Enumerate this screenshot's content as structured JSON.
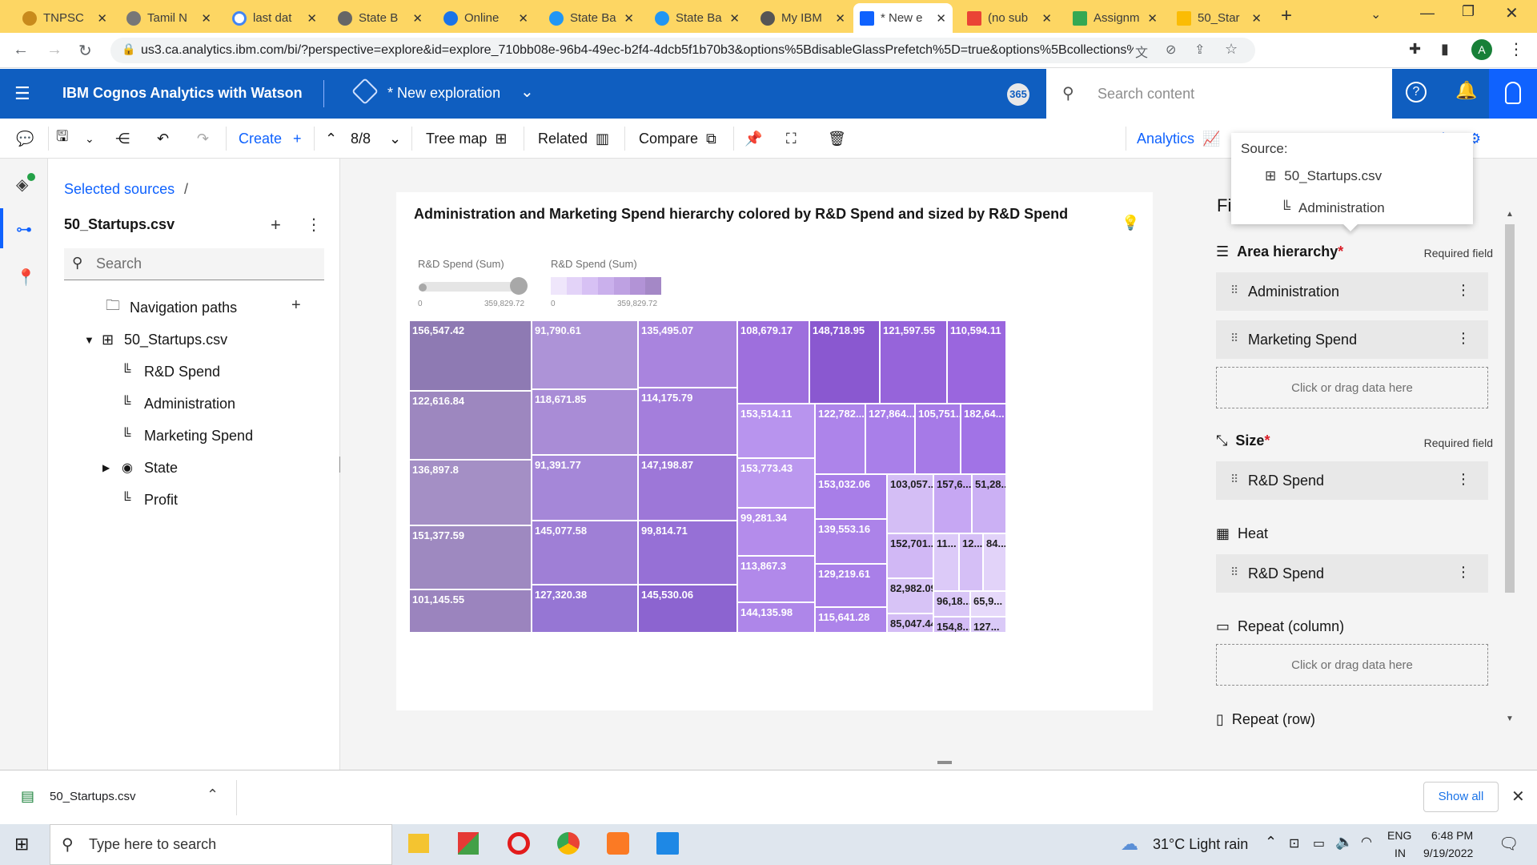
{
  "browser": {
    "tabs": [
      {
        "label": "TNPSC",
        "active": false
      },
      {
        "label": "Tamil N",
        "active": false
      },
      {
        "label": "last dat",
        "active": false
      },
      {
        "label": "State B",
        "active": false
      },
      {
        "label": "Online",
        "active": false
      },
      {
        "label": "State Ba",
        "active": false
      },
      {
        "label": "State Ba",
        "active": false
      },
      {
        "label": "My IBM",
        "active": false
      },
      {
        "label": "* New e",
        "active": true
      },
      {
        "label": "(no sub",
        "active": false
      },
      {
        "label": "Assignm",
        "active": false
      },
      {
        "label": "50_Star",
        "active": false
      }
    ],
    "url": "us3.ca.analytics.ibm.com/bi/?perspective=explore&id=explore_710bb08e-96b4-49ec-b2f4-4dcb5f1b70b3&options%5BdisableGlassPrefetch%5D=true&options%5Bcollections%5D...",
    "profile_initial": "A"
  },
  "header": {
    "app_title": "IBM Cognos Analytics with Watson",
    "exploration_title": "* New exploration",
    "badge": "365",
    "search_placeholder": "Search content"
  },
  "toolbar": {
    "create_label": "Create",
    "page_counter": "8/8",
    "treemap_label": "Tree map",
    "related_label": "Related",
    "compare_label": "Compare",
    "analytics_label": "Analytics",
    "properties_label": "rties"
  },
  "source_panel": {
    "breadcrumb": "Selected sources",
    "breadcrumb_sep": "/",
    "source_name": "50_Startups.csv",
    "search_placeholder": "Search",
    "tree": [
      {
        "label": "Navigation paths",
        "icon": "folder-icon"
      },
      {
        "label": "50_Startups.csv",
        "icon": "table-icon"
      },
      {
        "label": "R&D Spend",
        "icon": "measure-icon"
      },
      {
        "label": "Administration",
        "icon": "measure-icon"
      },
      {
        "label": "Marketing Spend",
        "icon": "measure-icon"
      },
      {
        "label": "State",
        "icon": "location-icon"
      },
      {
        "label": "Profit",
        "icon": "measure-icon"
      }
    ]
  },
  "visualization": {
    "title": "Administration and Marketing Spend hierarchy colored by R&D Spend and sized by R&D Spend",
    "legend_size_label": "R&D Spend (Sum)",
    "legend_color_label": "R&D Spend (Sum)",
    "legend_min": "0",
    "legend_max": "359,829.72",
    "treemap_labels": [
      "156,547.42",
      "122,616.84",
      "136,897.8",
      "151,377.59",
      "101,145.55",
      "91,790.61",
      "118,671.85",
      "91,391.77",
      "145,077.58",
      "127,320.38",
      "135,495.07",
      "114,175.79",
      "147,198.87",
      "99,814.71",
      "145,530.06",
      "108,679.17",
      "148,718.95",
      "121,597.55",
      "110,594.11",
      "153,514.11",
      "153,773.43",
      "99,281.34",
      "113,867.3",
      "144,135.98",
      "122,782....",
      "127,864....",
      "105,751...",
      "182,64...",
      "153,032.06",
      "139,553.16",
      "129,219.61",
      "115,641.28",
      "103,057...",
      "157,6...",
      "51,28...",
      "152,701...",
      "11...",
      "12...",
      "84...",
      "82,982.09",
      "96,18...",
      "65,9...",
      "85,047.44",
      "154,8...",
      "127..."
    ]
  },
  "popover": {
    "title": "Source:",
    "source": "50_Startups.csv",
    "item": "Administration"
  },
  "fields_panel": {
    "heading_partial": "Fi",
    "area_hierarchy_label": "Area hierarchy",
    "required_field": "Required field",
    "area_fields": [
      "Administration",
      "Marketing Spend"
    ],
    "drop_hint": "Click or drag data here",
    "size_label": "Size",
    "size_field": "R&D Spend",
    "heat_label": "Heat",
    "heat_field": "R&D Spend",
    "repeat_column_label": "Repeat (column)",
    "repeat_row_label": "Repeat (row)",
    "required_marker": "*"
  },
  "downloads": {
    "file": "50_Startups.csv",
    "show_all": "Show all"
  },
  "taskbar": {
    "search_placeholder": "Type here to search",
    "weather": "31°C  Light rain",
    "lang": "ENG",
    "region": "IN",
    "time": "6:48 PM",
    "date": "9/19/2022"
  }
}
